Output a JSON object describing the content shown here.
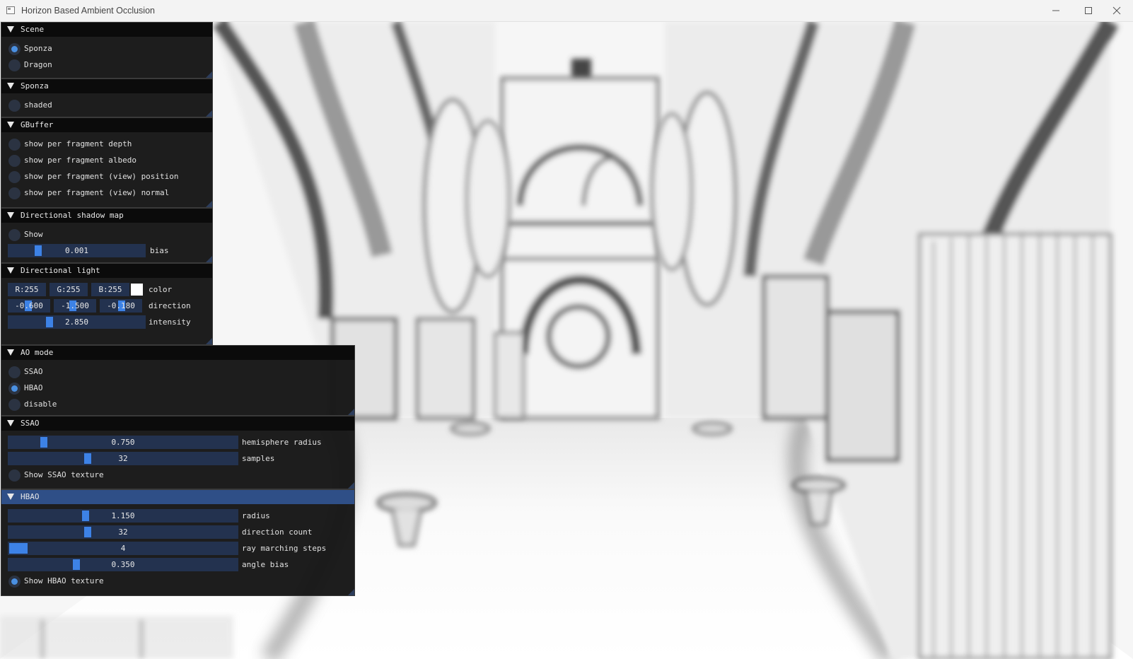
{
  "window": {
    "title": "Horizon Based Ambient Occlusion"
  },
  "panels": {
    "scene": {
      "header": "Scene",
      "options": [
        {
          "label": "Sponza",
          "selected": true
        },
        {
          "label": "Dragon",
          "selected": false
        }
      ]
    },
    "sponza": {
      "header": "Sponza",
      "shaded_label": "shaded",
      "shaded_on": false
    },
    "gbuffer": {
      "header": "GBuffer",
      "options": [
        {
          "label": "show per fragment depth"
        },
        {
          "label": "show per fragment albedo"
        },
        {
          "label": "show per fragment (view) position"
        },
        {
          "label": "show per fragment (view) normal"
        }
      ]
    },
    "shadow": {
      "header": "Directional shadow map",
      "show_label": "Show",
      "bias_value": "0.001",
      "bias_label": "bias",
      "bias_fraction": 0.2
    },
    "light": {
      "header": "Directional light",
      "r": "R:255",
      "g": "G:255",
      "b": "B:255",
      "color_label": "color",
      "color_value": "#ffffff",
      "dir_x": "-0.600",
      "dir_y": "-1.500",
      "dir_z": "-0.180",
      "direction_label": "direction",
      "intensity_value": "2.850",
      "intensity_label": "intensity",
      "intensity_fraction": 0.29
    },
    "aomode": {
      "header": "AO mode",
      "options": [
        {
          "label": "SSAO",
          "selected": false
        },
        {
          "label": "HBAO",
          "selected": true
        },
        {
          "label": "disable",
          "selected": false
        }
      ]
    },
    "ssao": {
      "header": "SSAO",
      "radius_value": "0.750",
      "radius_label": "hemisphere radius",
      "radius_fraction": 0.14,
      "samples_value": "32",
      "samples_label": "samples",
      "samples_fraction": 0.34,
      "texture_label": "Show SSAO texture",
      "texture_on": false
    },
    "hbao": {
      "header": "HBAO",
      "radius_value": "1.150",
      "radius_label": "radius",
      "radius_fraction": 0.33,
      "dir_value": "32",
      "dir_label": "direction count",
      "dir_fraction": 0.34,
      "steps_value": "4",
      "steps_label": "ray marching steps",
      "steps_fraction": 0.0,
      "bias_value": "0.350",
      "bias_label": "angle bias",
      "bias_fraction": 0.29,
      "texture_label": "Show HBAO texture",
      "texture_on": true
    }
  }
}
